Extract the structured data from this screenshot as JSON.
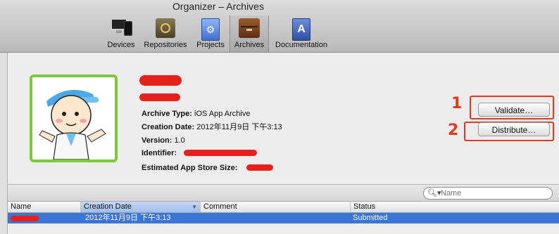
{
  "window": {
    "title": "Organizer – Archives"
  },
  "toolbar": {
    "items": [
      {
        "label": "Devices",
        "icon": "devices-icon"
      },
      {
        "label": "Repositories",
        "icon": "repositories-icon"
      },
      {
        "label": "Projects",
        "icon": "projects-icon"
      },
      {
        "label": "Archives",
        "icon": "archives-icon",
        "selected": true
      },
      {
        "label": "Documentation",
        "icon": "documentation-icon"
      }
    ]
  },
  "archive": {
    "type_label": "Archive Type:",
    "type_value": "iOS App Archive",
    "creation_label": "Creation Date:",
    "creation_value": "2012年11月9日 下午3:13",
    "version_label": "Version:",
    "version_value": "1.0",
    "identifier_label": "Identifier:",
    "size_label": "Estimated App Store Size:"
  },
  "actions": {
    "validate_label": "Validate…",
    "distribute_label": "Distribute…"
  },
  "annotations": {
    "one": "1",
    "two": "2",
    "color": "#e33a1f"
  },
  "search": {
    "placeholder": "Name"
  },
  "table": {
    "columns": [
      "Name",
      "Creation Date",
      "Comment",
      "Status"
    ],
    "sorted_column": "Creation Date",
    "rows": [
      {
        "name": "",
        "creation_date": "2012年11月9日 下午3:13",
        "comment": "",
        "status": "Submitted",
        "selected": true
      }
    ]
  },
  "colors": {
    "selection": "#3875d7",
    "redaction": "#e8201c",
    "icon_border": "#7ec83c"
  }
}
